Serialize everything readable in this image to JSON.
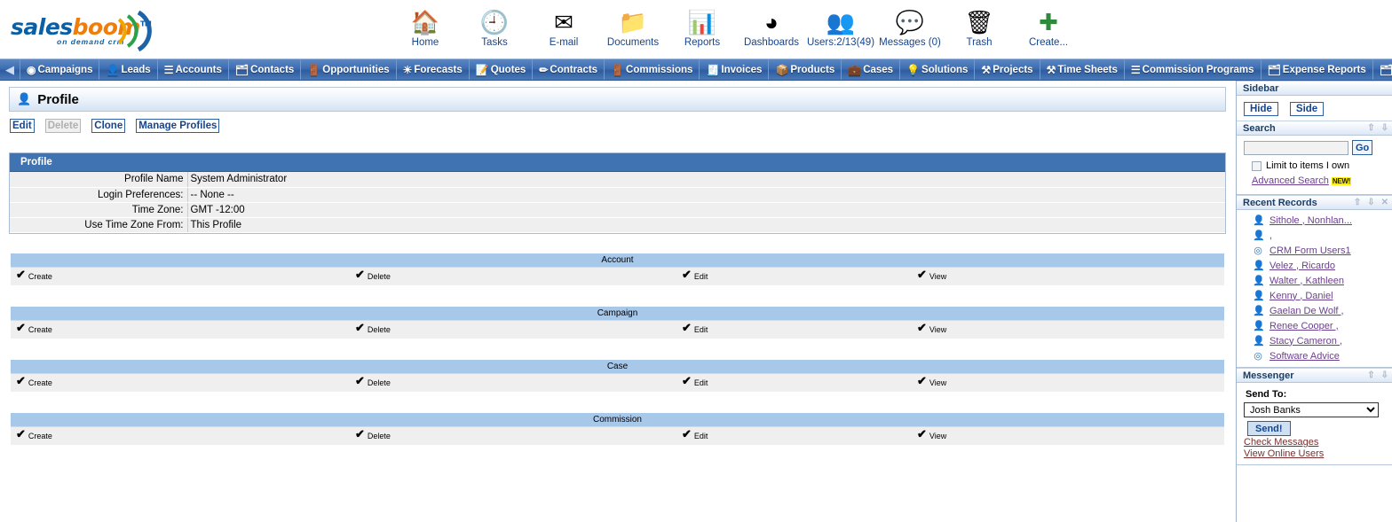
{
  "brand": {
    "name_part1": "sales",
    "name_part2": "boom",
    "tm": "TM",
    "tagline": "on demand crm",
    "color_primary": "#0b5fa5",
    "color_accent": "#ee7d0b"
  },
  "topnav": [
    {
      "label": "Home",
      "icon": "home-icon",
      "glyph": "⌂"
    },
    {
      "label": "Tasks",
      "icon": "clock-icon",
      "glyph": "⏱"
    },
    {
      "label": "E-mail",
      "icon": "envelope-icon",
      "glyph": "✉"
    },
    {
      "label": "Documents",
      "icon": "folder-icon",
      "glyph": "📁"
    },
    {
      "label": "Reports",
      "icon": "reports-icon",
      "glyph": "📊"
    },
    {
      "label": "Dashboards",
      "icon": "pie-chart-icon",
      "glyph": "◕"
    },
    {
      "label": "Users:2/13(49)",
      "icon": "users-icon",
      "glyph": "👥"
    },
    {
      "label": "Messages (0)",
      "icon": "speech-bubble-icon",
      "glyph": "💬"
    },
    {
      "label": "Trash",
      "icon": "trash-icon",
      "glyph": "🗑"
    },
    {
      "label": "Create...",
      "icon": "plus-icon",
      "glyph": "➕"
    }
  ],
  "tabs": {
    "left_arrow": "◀",
    "right_arrow": "▶",
    "items": [
      {
        "label": "Campaigns",
        "icon": "campaigns-icon",
        "glyph": "◎"
      },
      {
        "label": "Leads",
        "icon": "leads-icon",
        "glyph": "👤"
      },
      {
        "label": "Accounts",
        "icon": "accounts-icon",
        "glyph": "☰"
      },
      {
        "label": "Contacts",
        "icon": "contacts-icon",
        "glyph": "📇"
      },
      {
        "label": "Opportunities",
        "icon": "opportunities-icon",
        "glyph": "🚪"
      },
      {
        "label": "Forecasts",
        "icon": "forecasts-icon",
        "glyph": "☀"
      },
      {
        "label": "Quotes",
        "icon": "quotes-icon",
        "glyph": "📝"
      },
      {
        "label": "Contracts",
        "icon": "contracts-icon",
        "glyph": "✏"
      },
      {
        "label": "Commissions",
        "icon": "commissions-icon",
        "glyph": "🚪"
      },
      {
        "label": "Invoices",
        "icon": "invoices-icon",
        "glyph": "🧾"
      },
      {
        "label": "Products",
        "icon": "products-icon",
        "glyph": "📦"
      },
      {
        "label": "Cases",
        "icon": "cases-icon",
        "glyph": "💼"
      },
      {
        "label": "Solutions",
        "icon": "solutions-icon",
        "glyph": "💡"
      },
      {
        "label": "Projects",
        "icon": "projects-icon",
        "glyph": "⚒"
      },
      {
        "label": "Time Sheets",
        "icon": "time-sheets-icon",
        "glyph": "⚒"
      },
      {
        "label": "Commission Programs",
        "icon": "commission-programs-icon",
        "glyph": "☰"
      },
      {
        "label": "Expense Reports",
        "icon": "expense-reports-icon",
        "glyph": "📇"
      },
      {
        "label": "",
        "icon": "more-tab-icon",
        "glyph": "📇"
      }
    ]
  },
  "page": {
    "title": "Profile",
    "title_icon": "person-icon"
  },
  "actions": [
    {
      "label": "Edit",
      "name": "edit-button",
      "disabled": false
    },
    {
      "label": "Delete",
      "name": "delete-button",
      "disabled": true
    },
    {
      "label": "Clone",
      "name": "clone-button",
      "disabled": false
    },
    {
      "label": "Manage Profiles",
      "name": "manage-profiles-button",
      "disabled": false
    }
  ],
  "detail": {
    "section_title": "Profile",
    "rows": [
      {
        "label": "Profile Name",
        "value": "System Administrator"
      },
      {
        "label": "Login Preferences:",
        "value": "-- None --"
      },
      {
        "label": "Time Zone:",
        "value": "GMT -12:00"
      },
      {
        "label": "Use Time Zone From:",
        "value": "This Profile"
      }
    ]
  },
  "permissions": {
    "check_glyph": "✔",
    "groups": [
      {
        "title": "Account",
        "perms": [
          "Create",
          "Delete",
          "Edit",
          "View"
        ]
      },
      {
        "title": "Campaign",
        "perms": [
          "Create",
          "Delete",
          "Edit",
          "View"
        ]
      },
      {
        "title": "Case",
        "perms": [
          "Create",
          "Delete",
          "Edit",
          "View"
        ]
      },
      {
        "title": "Commission",
        "perms": [
          "Create",
          "Delete",
          "Edit",
          "View"
        ]
      }
    ]
  },
  "sidebar": {
    "header": "Sidebar",
    "buttons": [
      {
        "label": "Hide",
        "name": "hide-sidebar-button"
      },
      {
        "label": "Side",
        "name": "side-sidebar-button"
      }
    ],
    "search": {
      "header": "Search",
      "input_value": "",
      "placeholder": "",
      "go_label": "Go",
      "limit_label": "Limit to items I own",
      "limit_checked": false,
      "advanced_label": "Advanced Search",
      "new_badge": "NEW!",
      "up_ctl": "⇧",
      "down_ctl": "⇩"
    },
    "recent": {
      "header": "Recent Records",
      "up_ctl": "⇧",
      "down_ctl": "⇩",
      "items": [
        {
          "label": "Sithole , Nonhlan...",
          "icon": "person-icon"
        },
        {
          "label": ",",
          "icon": "person-icon"
        },
        {
          "label": "CRM Form Users1",
          "icon": "target-icon"
        },
        {
          "label": "Velez , Ricardo",
          "icon": "person-icon"
        },
        {
          "label": "Walter , Kathleen",
          "icon": "person-icon"
        },
        {
          "label": "Kenny , Daniel",
          "icon": "person-icon"
        },
        {
          "label": "Gaelan De Wolf ,",
          "icon": "person-icon"
        },
        {
          "label": "Renee Cooper ,",
          "icon": "person-icon"
        },
        {
          "label": "Stacy Cameron ,",
          "icon": "person-icon"
        },
        {
          "label": "Software Advice",
          "icon": "target-icon"
        }
      ]
    },
    "messenger": {
      "header": "Messenger",
      "up_ctl": "⇧",
      "down_ctl": "⇩",
      "send_to_label": "Send To:",
      "selected_user": "Josh Banks",
      "send_label": "Send!",
      "links": [
        {
          "label": "Check Messages",
          "name": "check-messages-link"
        },
        {
          "label": "View Online Users",
          "name": "view-online-users-link"
        }
      ]
    }
  }
}
